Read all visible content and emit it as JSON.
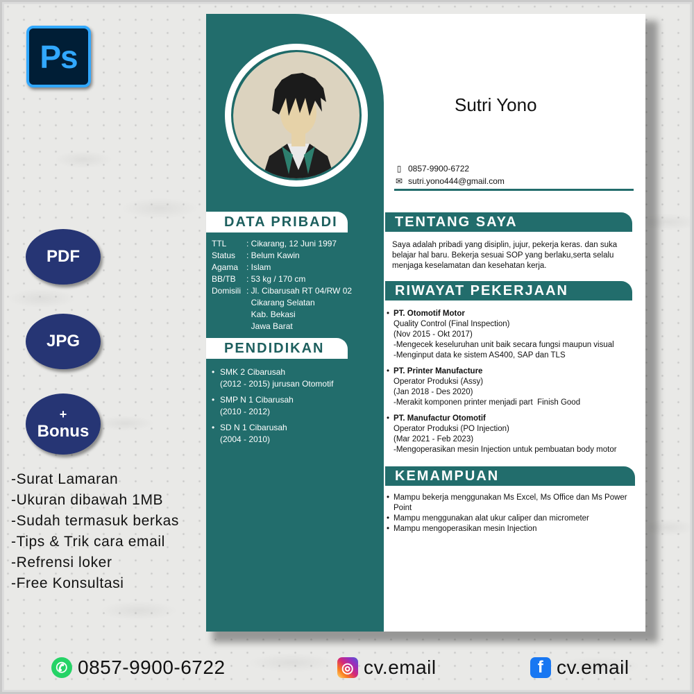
{
  "promo": {
    "app_logo": "Ps",
    "badges": {
      "pdf": "PDF",
      "jpg": "JPG",
      "bonus_plus": "+",
      "bonus": "Bonus"
    },
    "bonus_items": [
      "-Surat Lamaran",
      "-Ukuran dibawah 1MB",
      "-Sudah termasuk berkas",
      "-Tips & Trik cara email",
      "-Refrensi loker",
      "-Free Konsultasi"
    ],
    "contacts": {
      "whatsapp": "0857-9900-6722",
      "instagram": "cv.email",
      "facebook": "cv.email"
    }
  },
  "cv": {
    "name": "Sutri Yono",
    "phone": "0857-9900-6722",
    "email": "sutri.yono444@gmail.com",
    "sections": {
      "data_pribadi": "DATA PRIBADI",
      "pendidikan": "PENDIDIKAN",
      "tentang_saya": "TENTANG SAYA",
      "riwayat": "RIWAYAT PEKERJAAN",
      "kemampuan": "KEMAMPUAN"
    },
    "personal": [
      {
        "k": "TTL",
        "v": ": Cikarang, 12 Juni 1997"
      },
      {
        "k": "Status",
        "v": ": Belum Kawin"
      },
      {
        "k": "Agama",
        "v": ": Islam"
      },
      {
        "k": "BB/TB",
        "v": ": 53 kg / 170 cm"
      },
      {
        "k": "Domisili",
        "v": ": Jl. Cibarusah RT 04/RW 02"
      },
      {
        "k": "",
        "v": "  Cikarang Selatan"
      },
      {
        "k": "",
        "v": "  Kab. Bekasi"
      },
      {
        "k": "",
        "v": "  Jawa Barat"
      }
    ],
    "education": [
      {
        "school": "SMK 2 Cibarusah",
        "detail": "(2012 - 2015) jurusan Otomotif"
      },
      {
        "school": "SMP N 1 Cibarusah",
        "detail": "(2010 - 2012)"
      },
      {
        "school": "SD N 1 Cibarusah",
        "detail": "(2004 - 2010)"
      }
    ],
    "about": "Saya adalah pribadi yang disiplin, jujur, pekerja keras. dan suka belajar hal baru. Bekerja sesuai SOP yang berlaku,serta selalu menjaga keselamatan dan kesehatan kerja.",
    "jobs": [
      {
        "company": "PT. Otomotif Motor",
        "lines": [
          "Quality Control (Final Inspection)",
          "(Nov 2015 - Okt 2017)",
          "-Mengecek keseluruhan unit baik secara fungsi maupun visual",
          "-Menginput data ke sistem AS400, SAP dan TLS"
        ]
      },
      {
        "company": "PT. Printer Manufacture",
        "lines": [
          "Operator Produksi (Assy)",
          "(Jan 2018 - Des 2020)",
          "-Merakit komponen printer menjadi part  Finish Good"
        ]
      },
      {
        "company": "PT. Manufactur Otomotif",
        "lines": [
          "Operator Produksi (PO Injection)",
          "(Mar 2021 - Feb 2023)",
          "-Mengoperasikan mesin Injection untuk pembuatan body motor"
        ]
      }
    ],
    "skills": [
      "Mampu bekerja menggunakan Ms Excel, Ms Office dan Ms Power Point",
      "Mampu menggunakan alat ukur caliper dan micrometer",
      "Mampu mengoperasikan mesin Injection"
    ]
  },
  "colors": {
    "teal": "#226d6c",
    "badge_navy": "#263574",
    "ps_blue": "#31a8ff"
  }
}
